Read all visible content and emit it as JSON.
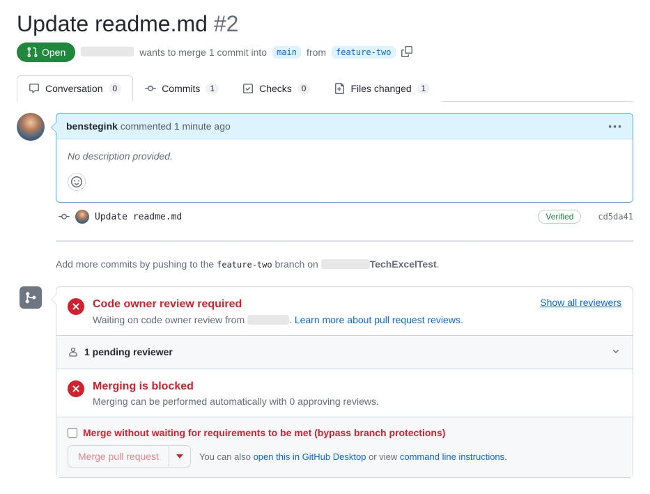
{
  "header": {
    "title": "Update readme.md",
    "number": "#2",
    "state": "Open",
    "merge_text_1": "wants to merge 1 commit into",
    "base_branch": "main",
    "from_text": "from",
    "head_branch": "feature-two"
  },
  "tabs": {
    "conversation": {
      "label": "Conversation",
      "count": "0"
    },
    "commits": {
      "label": "Commits",
      "count": "1"
    },
    "checks": {
      "label": "Checks",
      "count": "0"
    },
    "files": {
      "label": "Files changed",
      "count": "1"
    }
  },
  "comment": {
    "author": "benstegink",
    "commented": "commented",
    "time": "1 minute ago",
    "body": "No description provided."
  },
  "commit": {
    "message": "Update readme.md",
    "verified": "Verified",
    "sha": "cd5da41"
  },
  "push_hint": {
    "prefix": "Add more commits by pushing to the",
    "branch": "feature-two",
    "mid": "branch on",
    "repo_suffix": "TechExcelTest",
    "end": "."
  },
  "merge": {
    "review_title": "Code owner review required",
    "review_sub_prefix": "Waiting on code owner review from",
    "review_sub_suffix": ".",
    "learn_more": "Learn more about pull request reviews.",
    "show_all": "Show all reviewers",
    "pending": "1 pending reviewer",
    "blocked_title": "Merging is blocked",
    "blocked_sub": "Merging can be performed automatically with 0 approving reviews.",
    "bypass_label": "Merge without waiting for requirements to be met (bypass branch protections)",
    "merge_btn": "Merge pull request",
    "also_prefix": "You can also",
    "desktop_link": "open this in GitHub Desktop",
    "also_mid": "or view",
    "cli_link": "command line instructions",
    "also_end": "."
  }
}
